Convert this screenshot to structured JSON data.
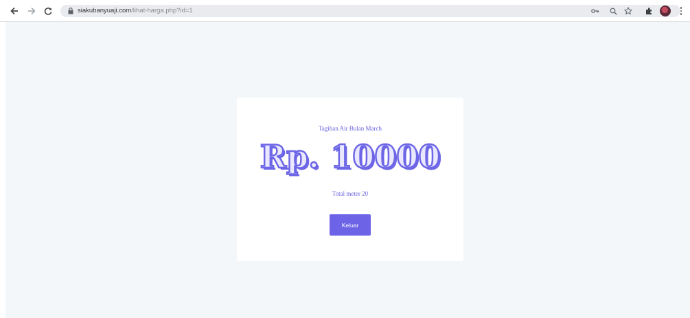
{
  "browser": {
    "url_host": "siakubanyuaji.com",
    "url_path": "/lihat-harga.php?id=1"
  },
  "card": {
    "title": "Tagihan Air Bulan March",
    "amount": "Rp. 10000",
    "meter_text": "Total meter 20",
    "button_label": "Keluar"
  },
  "colors": {
    "accent": "#6c63e6",
    "page_background": "#f3f7fa",
    "card_background": "#ffffff"
  },
  "icons": [
    "back-arrow-icon",
    "forward-arrow-icon",
    "reload-icon",
    "lock-icon",
    "key-icon",
    "zoom-icon",
    "star-icon",
    "extensions-puzzle-icon",
    "profile-avatar",
    "kebab-menu-icon"
  ]
}
